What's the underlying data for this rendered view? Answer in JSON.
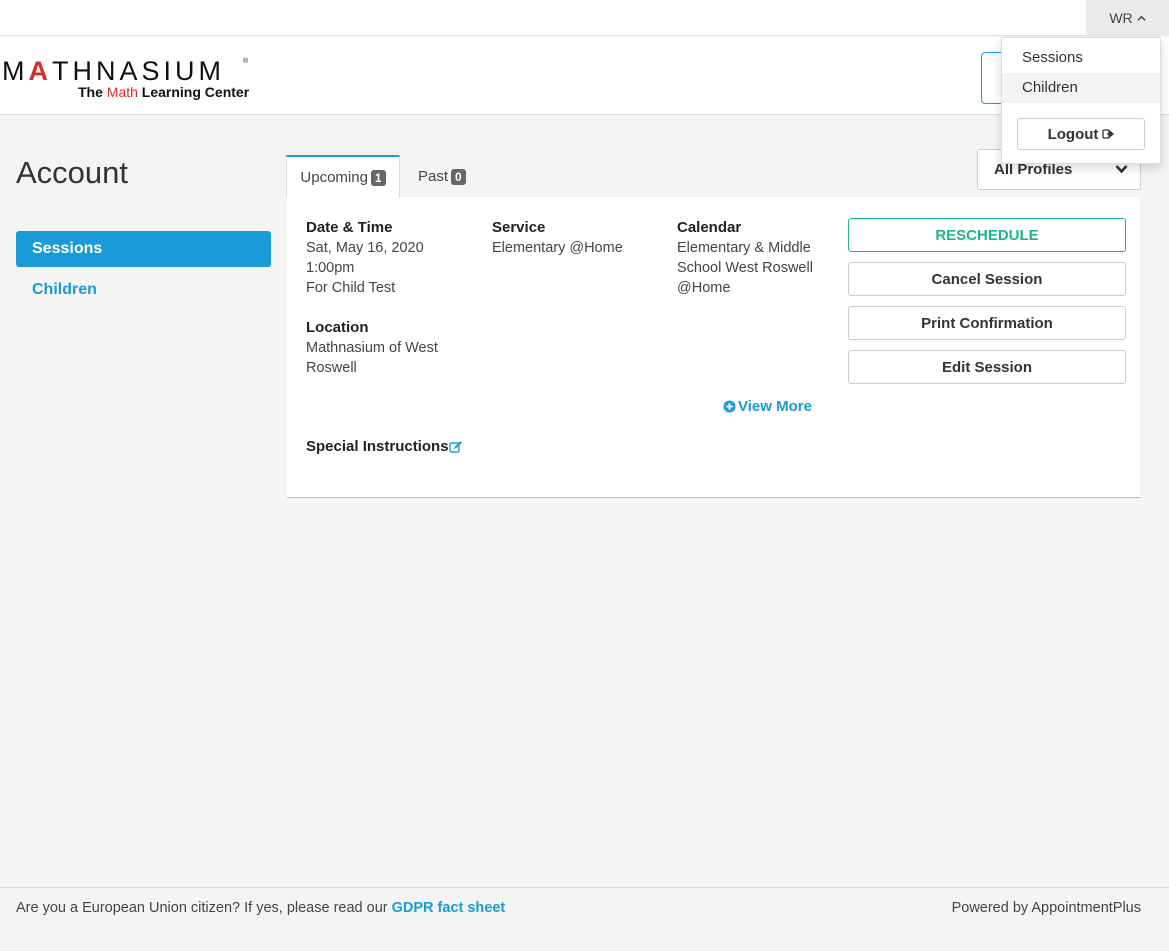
{
  "topbar": {
    "user_initials": "WR"
  },
  "logo": {
    "word_pre": "M",
    "word_red": "A",
    "word_post": "THNASIUM",
    "registered": "®",
    "tag_pre": "The ",
    "tag_red": "Math",
    "tag_post": " Learning Center"
  },
  "user_menu": {
    "items": [
      {
        "label": "Sessions"
      },
      {
        "label": "Children"
      }
    ],
    "logout_label": "Logout"
  },
  "page": {
    "title": "Account"
  },
  "sidebar": {
    "items": [
      {
        "label": "Sessions",
        "active": true
      },
      {
        "label": "Children",
        "active": false
      }
    ]
  },
  "tabs": [
    {
      "label": "Upcoming",
      "count": "1",
      "active": true
    },
    {
      "label": "Past",
      "count": "0",
      "active": false
    }
  ],
  "profile_filter": {
    "selected": "All Profiles"
  },
  "session": {
    "datetime_label": "Date & Time",
    "date": "Sat, May 16, 2020",
    "time": "1:00pm",
    "for": "For Child Test",
    "service_label": "Service",
    "service": "Elementary @Home",
    "calendar_label": "Calendar",
    "calendar_line1": "Elementary & Middle",
    "calendar_line2": "School West Roswell",
    "calendar_line3": "@Home",
    "location_label": "Location",
    "location_line1": "Mathnasium of West",
    "location_line2": "Roswell",
    "view_more": "View More",
    "special_instructions": "Special Instructions"
  },
  "actions": {
    "reschedule": "RESCHEDULE",
    "cancel": "Cancel Session",
    "print": "Print Confirmation",
    "edit": "Edit Session"
  },
  "footer": {
    "gdpr_text": "Are you a European Union citizen? If yes, please read our ",
    "gdpr_link": "GDPR fact sheet",
    "powered_by": "Powered by AppointmentPlus"
  },
  "colors": {
    "accent": "#1a9bd7",
    "reschedule": "#21b38a",
    "brand_red": "#d82c2c"
  }
}
